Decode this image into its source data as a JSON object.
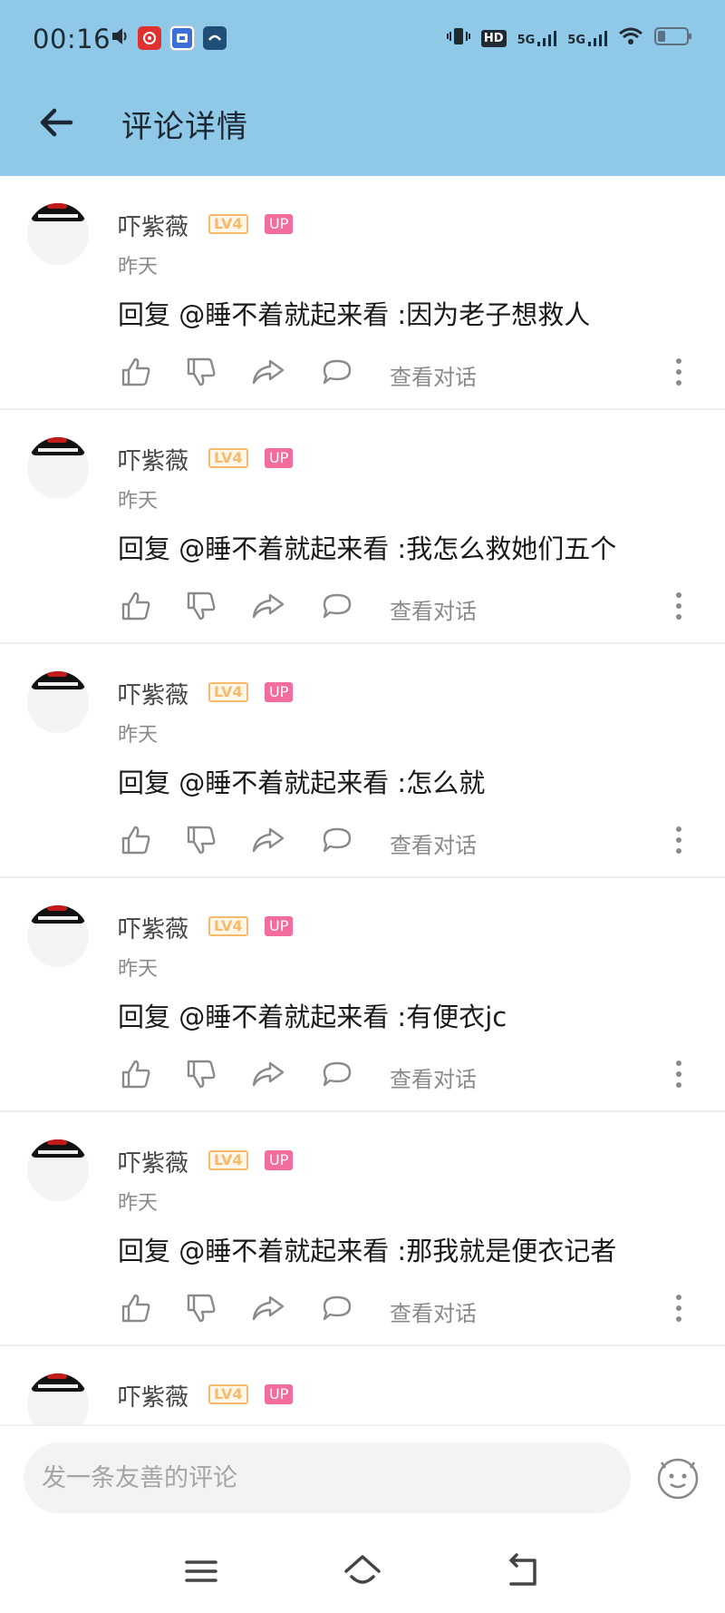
{
  "status_bar": {
    "time": "00:16",
    "left_icons": [
      "volume-icon",
      "netease-music-icon",
      "tieba-icon",
      "app-icon"
    ],
    "right_icons": [
      "vibrate-icon",
      "hd-icon",
      "5g-signal-icon",
      "5g-signal-icon",
      "wifi-icon",
      "battery-icon"
    ],
    "hd_label": "HD",
    "signal_label_1": "5G",
    "signal_label_2": "5G"
  },
  "header": {
    "title": "评论详情"
  },
  "comments": [
    {
      "username": "吓紫薇",
      "level": "LV4",
      "badge": "UP",
      "time": "昨天",
      "content": "回复 @睡不着就起来看 :因为老子想救人",
      "view_conversation": "查看对话"
    },
    {
      "username": "吓紫薇",
      "level": "LV4",
      "badge": "UP",
      "time": "昨天",
      "content": "回复 @睡不着就起来看 :我怎么救她们五个",
      "view_conversation": "查看对话"
    },
    {
      "username": "吓紫薇",
      "level": "LV4",
      "badge": "UP",
      "time": "昨天",
      "content": "回复 @睡不着就起来看 :怎么就",
      "view_conversation": "查看对话"
    },
    {
      "username": "吓紫薇",
      "level": "LV4",
      "badge": "UP",
      "time": "昨天",
      "content": "回复 @睡不着就起来看 :有便衣jc",
      "view_conversation": "查看对话"
    },
    {
      "username": "吓紫薇",
      "level": "LV4",
      "badge": "UP",
      "time": "昨天",
      "content": "回复 @睡不着就起来看 :那我就是便衣记者",
      "view_conversation": "查看对话"
    },
    {
      "username": "吓紫薇",
      "level": "LV4",
      "badge": "UP",
      "time": "",
      "content": "",
      "view_conversation": ""
    }
  ],
  "composer": {
    "placeholder": "发一条友善的评论"
  },
  "colors": {
    "header_bg": "#90c9e7",
    "level_badge": "#f7b96c",
    "up_badge": "#f36c9d",
    "muted_text": "#8a8a8a"
  }
}
